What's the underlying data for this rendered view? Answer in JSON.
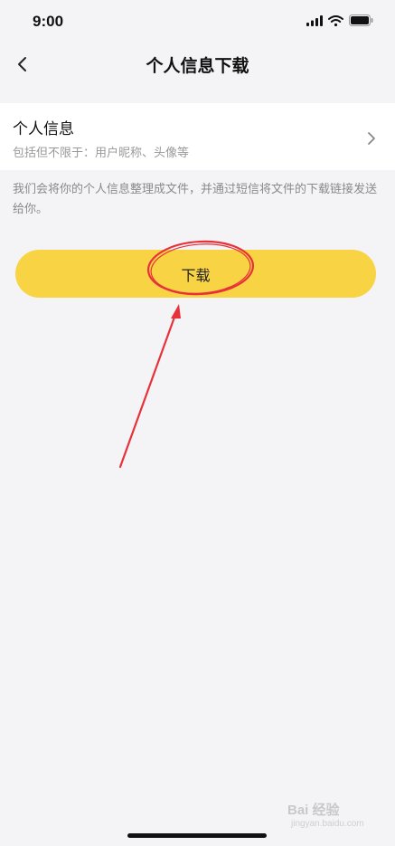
{
  "status": {
    "time": "9:00",
    "icons": [
      "cellular-signal-icon",
      "wifi-icon",
      "battery-icon"
    ]
  },
  "nav": {
    "title": "个人信息下载",
    "back_icon": "chevron-left-icon"
  },
  "info_card": {
    "title": "个人信息",
    "subtitle": "包括但不限于：用户昵称、头像等",
    "icon": "chevron-right-icon"
  },
  "notice": "我们会将你的个人信息整理成文件，并通过短信将文件的下载链接发送给你。",
  "download": {
    "label": "下载"
  },
  "colors": {
    "button": "#f8d343",
    "annotation": "#e8313a",
    "background": "#f4f4f6"
  },
  "watermark": {
    "text": "Bai 经验",
    "sub": "jingyan.baidu.com"
  }
}
